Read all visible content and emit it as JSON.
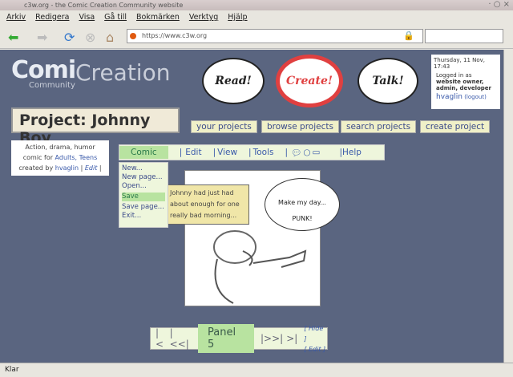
{
  "window": {
    "title": "c3w.org - the Comic Creation Community website"
  },
  "menu": [
    "Arkiv",
    "Redigera",
    "Visa",
    "Gå till",
    "Bokmärken",
    "Verktyg",
    "Hjälp"
  ],
  "address": {
    "url": "https://www.c3w.org"
  },
  "logo": {
    "part1": "Comi",
    "part2": "Creation",
    "part3": "Community"
  },
  "bubbles": {
    "read": "Read!",
    "create": "Create!",
    "talk": "Talk!"
  },
  "user": {
    "date": "Thursday, 11 Nov, 17:43",
    "logged_in_as": "Logged in as",
    "roles": "website owner, admin, developer",
    "name": "hvaglin",
    "logout": "(logout)"
  },
  "project": {
    "label": "Project:",
    "name": "Johnny Boy"
  },
  "nav": [
    "your projects",
    "browse projects",
    "search projects",
    "create project"
  ],
  "desc": {
    "genre": "Action, drama, humor",
    "for_prefix": "comic for",
    "audience": "Adults, Teens",
    "created_by": "created by",
    "author": "hvaglin",
    "edit": "Edit"
  },
  "editor_menu": {
    "comic": "Comic",
    "edit": "Edit",
    "view": "View",
    "tools": "Tools",
    "help": "Help"
  },
  "dropdown": [
    "New...",
    "New page...",
    "Open...",
    "Save",
    "Save page...",
    "Exit..."
  ],
  "panel": {
    "caption": "Johnny had just had about enough for one really bad morning...",
    "speech1": "Make my day...",
    "speech2": "PUNK!"
  },
  "panel_nav": {
    "first": "|<",
    "prev": "|<<|",
    "label": "Panel 5",
    "next": "|>>|",
    "last": ">|",
    "hide": "Hide",
    "edit": "Edit"
  },
  "status": "Klar"
}
